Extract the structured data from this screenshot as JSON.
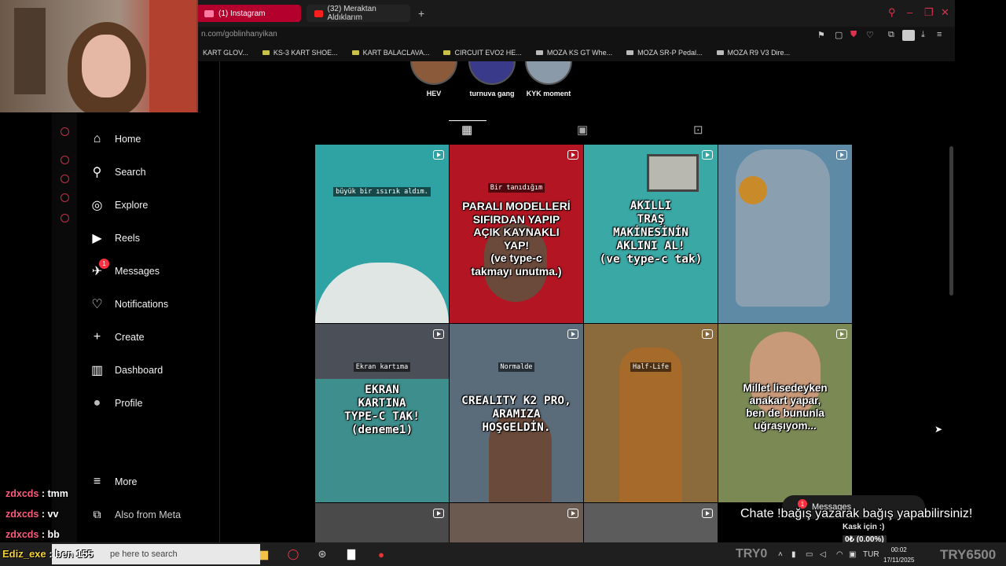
{
  "browser": {
    "tabs": [
      {
        "label": "(1) Instagram",
        "active": true
      },
      {
        "label": "(32) Meraktan Aldıklarım",
        "active": false
      }
    ],
    "new_tab_symbol": "+",
    "url": "n.com/goblinhanyikan",
    "bookmarks": [
      "KART GLOV...",
      "KS-3 KART SHOE...",
      "KART BALACLAVA...",
      "CIRCUIT EVO2 HE...",
      "MOZA KS GT Whe...",
      "MOZA SR-P Pedal...",
      "MOZA R9 V3 Dire..."
    ],
    "accent": "#b3002d"
  },
  "sidebar": {
    "items": [
      {
        "label": "Home",
        "icon": "home-icon",
        "glyph": "⌂"
      },
      {
        "label": "Search",
        "icon": "search-icon",
        "glyph": "⚲"
      },
      {
        "label": "Explore",
        "icon": "compass-icon",
        "glyph": "◎"
      },
      {
        "label": "Reels",
        "icon": "reels-icon",
        "glyph": "▶"
      },
      {
        "label": "Messages",
        "icon": "messenger-icon",
        "glyph": "✈",
        "badge": "1"
      },
      {
        "label": "Notifications",
        "icon": "heart-icon",
        "glyph": "♡"
      },
      {
        "label": "Create",
        "icon": "plus-icon",
        "glyph": "+"
      },
      {
        "label": "Dashboard",
        "icon": "dashboard-icon",
        "glyph": "▥"
      },
      {
        "label": "Profile",
        "icon": "avatar-icon",
        "glyph": "●"
      }
    ],
    "more": "More",
    "meta": "Also from Meta"
  },
  "profile": {
    "highlights": [
      "HEV",
      "turnuva gang",
      "KYK moment"
    ]
  },
  "grid": [
    {
      "small": "büyük bir ısırık aldım.",
      "big": "",
      "bg": "#2fa2a3"
    },
    {
      "small": "Bir tanıdığım",
      "big": "PARALI MODELLERİ\nSIFIRDAN YAPIP\nAÇIK KAYNAKLI\nYAP!\n(ve type-c\ntakmayı unutma.)",
      "bg": "#b31622"
    },
    {
      "small": "",
      "big": "AKILLI\nTRAŞ\nMAKİNESİNİN\nAKLINI AL!\n(ve type-c tak)",
      "bg": "#3aa8a5"
    },
    {
      "small": "",
      "big": "",
      "bg": "#5f8aa6"
    },
    {
      "small": "Ekran kartıma",
      "big": "EKRAN\nKARTINA\nTYPE-C TAK!\n(deneme1)",
      "bg": "#3d8e8c"
    },
    {
      "small": "Normalde",
      "big": "CREALITY K2 PRO,\nARAMIZA\nHOŞGELDİN.",
      "bg": "#5a6b7a"
    },
    {
      "small": "Half-Life",
      "big": "",
      "bg": "#8b6a3c"
    },
    {
      "small": "",
      "big": "Millet lisedeyken\nanakart yapar,\nben de bununla\nuğraşıyom...",
      "bg": "#7b8a55"
    },
    {
      "small": "",
      "big": "",
      "bg": "#4a4a4a"
    },
    {
      "small": "",
      "big": "",
      "bg": "#6a5a50"
    },
    {
      "small": "",
      "big": "",
      "bg": "#5c5c5c"
    }
  ],
  "overlay": {
    "chat": [
      {
        "user": "zdxcds",
        "msg": "tmm"
      },
      {
        "user": "zdxcds",
        "msg": "vv"
      },
      {
        "user": "zdxcds",
        "msg": "bb"
      }
    ],
    "ediz_user": "Ediz_exe",
    "ediz_msg": "ben 155",
    "donation": "Chate !bağış yazarak bağış yapabilirsiniz!",
    "goal_label": "Kask için :)",
    "goal_value": "0₺ (0.00%)",
    "goal_progress": 0,
    "messages_pill": "Messages",
    "messages_badge": "1"
  },
  "taskbar": {
    "search_placeholder": "pe here to search",
    "lang": "TUR",
    "time": "00:02",
    "date": "17/11/2025",
    "try0": "TRY0",
    "try6500": "TRY6500"
  }
}
